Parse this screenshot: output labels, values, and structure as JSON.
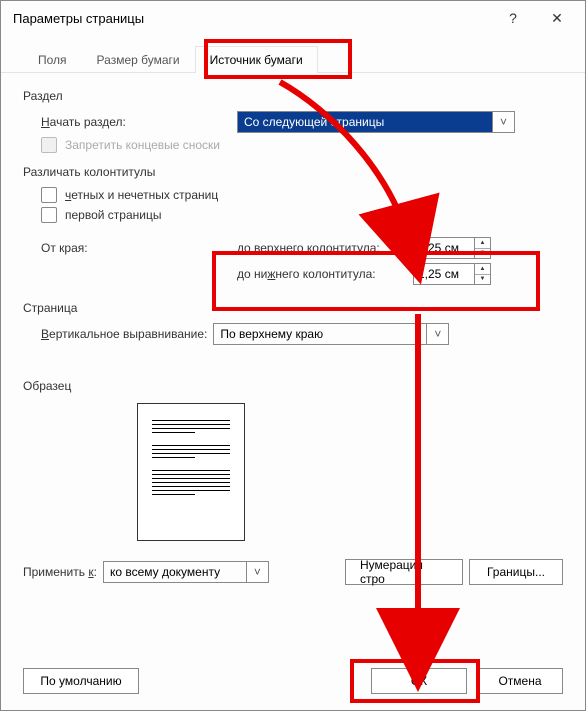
{
  "title": "Параметры страницы",
  "titlebar": {
    "help": "?",
    "close": "✕"
  },
  "tabs": {
    "fields": "Поля",
    "paper_size": "Размер бумаги",
    "paper_source": "Источник бумаги"
  },
  "section": {
    "group": "Раздел",
    "start_lbl_pre": "Н",
    "start_lbl_post": "ачать раздел:",
    "start_value": "Со следующей страницы",
    "suppress_endnotes": "Запретить концевые сноски"
  },
  "hdrftr": {
    "group": "Различать колонтитулы",
    "odd_even_pre": "ч",
    "odd_even_post": "етных и нечетных страниц",
    "first_page": "первой страницы",
    "from_edge": "От края:",
    "header_lbl_pre": "до верх",
    "header_lbl_u": "н",
    "header_lbl_post": "его колонтитула:",
    "footer_lbl_pre": "до ни",
    "footer_lbl_u": "ж",
    "footer_lbl_post": "него колонтитула:",
    "header_val": "1,25 см",
    "footer_val": "1,25 см"
  },
  "page": {
    "group": "Страница",
    "valign_lbl_pre": "В",
    "valign_lbl_post": "ертикальное выравнивание:",
    "valign_value": "По верхнему краю"
  },
  "preview": {
    "group": "Образец"
  },
  "apply": {
    "lbl_pre": "Применить ",
    "lbl_u": "к",
    "lbl_post": ":",
    "value": "ко всему документу",
    "numbering": "Нумерация стро",
    "borders": "Границы..."
  },
  "footer": {
    "defaults": "По умолчанию",
    "ok": "ОК",
    "cancel": "Отмена"
  }
}
